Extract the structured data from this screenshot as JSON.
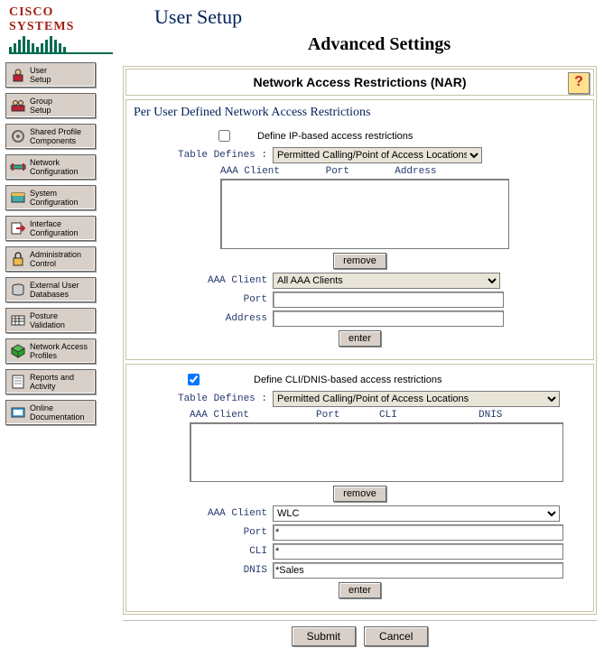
{
  "brand": "CISCO SYSTEMS",
  "page_title": "User Setup",
  "page_subtitle": "Advanced Settings",
  "sidebar": {
    "items": [
      {
        "label": "User\nSetup"
      },
      {
        "label": "Group\nSetup"
      },
      {
        "label": "Shared Profile\nComponents"
      },
      {
        "label": "Network\nConfiguration"
      },
      {
        "label": "System\nConfiguration"
      },
      {
        "label": "Interface\nConfiguration"
      },
      {
        "label": "Administration\nControl"
      },
      {
        "label": "External User\nDatabases"
      },
      {
        "label": "Posture\nValidation"
      },
      {
        "label": "Network Access\nProfiles"
      },
      {
        "label": "Reports and\nActivity"
      },
      {
        "label": "Online\nDocumentation"
      }
    ]
  },
  "nar": {
    "panel_title": "Network Access Restrictions (NAR)",
    "help_glyph": "?",
    "ip": {
      "section_title": "Per User Defined Network Access Restrictions",
      "checked": false,
      "option_label": "Define IP-based access restrictions",
      "table_defines_label": "Table Defines :",
      "table_defines_select": "Permitted Calling/Point of Access Locations",
      "col_aaa": "AAA Client",
      "col_port": "Port",
      "col_addr": "Address",
      "remove_btn": "remove",
      "aaa_client_label": "AAA Client",
      "aaa_client_select": "All AAA Clients",
      "port_label": "Port",
      "port_value": "",
      "addr_label": "Address",
      "addr_value": "",
      "enter_btn": "enter"
    },
    "cli": {
      "checked": true,
      "option_label": "Define CLI/DNIS-based access restrictions",
      "table_defines_label": "Table Defines :",
      "table_defines_select": "Permitted Calling/Point of Access Locations",
      "col_aaa": "AAA Client",
      "col_port": "Port",
      "col_cli": "CLI",
      "col_dnis": "DNIS",
      "remove_btn": "remove",
      "aaa_client_label": "AAA Client",
      "aaa_client_select": "WLC",
      "port_label": "Port",
      "port_value": "*",
      "cli_label": "CLI",
      "cli_value": "*",
      "dnis_label": "DNIS",
      "dnis_value": "*Sales",
      "enter_btn": "enter"
    }
  },
  "footer": {
    "submit": "Submit",
    "cancel": "Cancel"
  }
}
